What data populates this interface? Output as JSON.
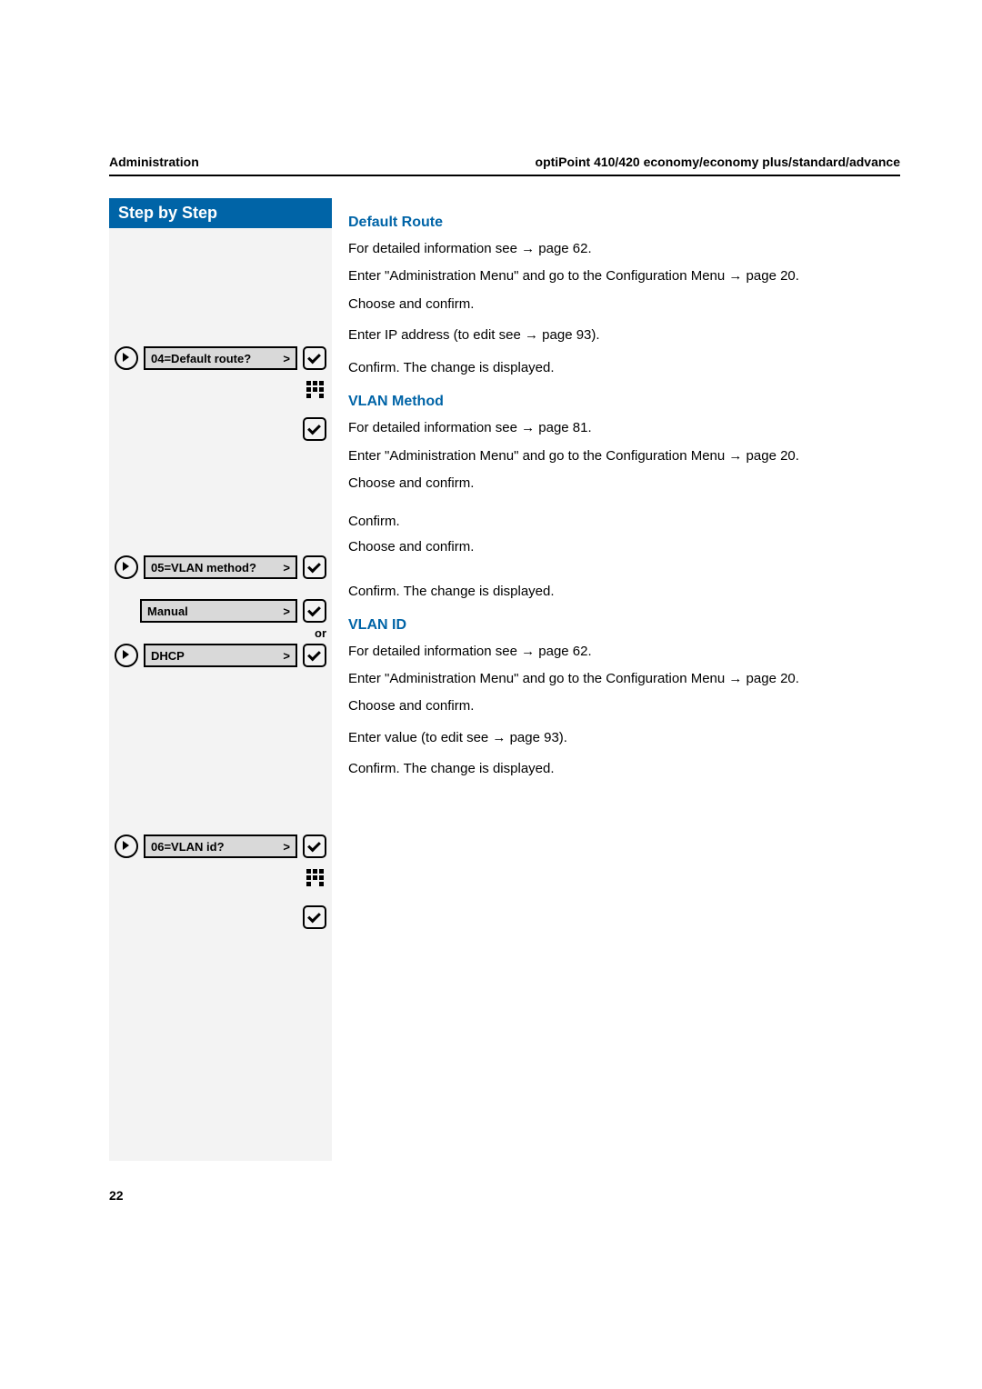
{
  "header": {
    "left": "Administration",
    "right": "optiPoint 410/420 economy/economy plus/standard/advance"
  },
  "step_title": "Step by Step",
  "or_label": "or",
  "gt": ">",
  "sections": {
    "s1": {
      "title": "Default Route",
      "detail": "For detailed information see → page 62.",
      "enter": "Enter \"Administration Menu\" and go to the Configuration Menu → page 20.",
      "choose": "Choose and confirm.",
      "enterip": "Enter IP address (to edit see → page 93).",
      "confirm": "Confirm. The change is displayed.",
      "lcd": "04=Default route?"
    },
    "s2": {
      "title": "VLAN Method",
      "detail": "For detailed information see → page 81.",
      "enter": "Enter \"Administration Menu\" and go to the Configuration Menu → page 20.",
      "choose": "Choose and confirm.",
      "confirm_a": "Confirm.",
      "choose2": "Choose and confirm.",
      "confirm_b": "Confirm. The change is displayed.",
      "lcd_main": "05=VLAN method?",
      "lcd_manual": "Manual",
      "lcd_dhcp": "DHCP"
    },
    "s3": {
      "title": "VLAN ID",
      "detail": "For detailed information see → page 62.",
      "enter": "Enter \"Administration Menu\" and go to the Configuration Menu → page 20.",
      "choose": "Choose and confirm.",
      "enterval": "Enter value (to edit see → page 93).",
      "confirm": "Confirm. The change is displayed.",
      "lcd": "06=VLAN id?"
    }
  },
  "page_number": "22"
}
